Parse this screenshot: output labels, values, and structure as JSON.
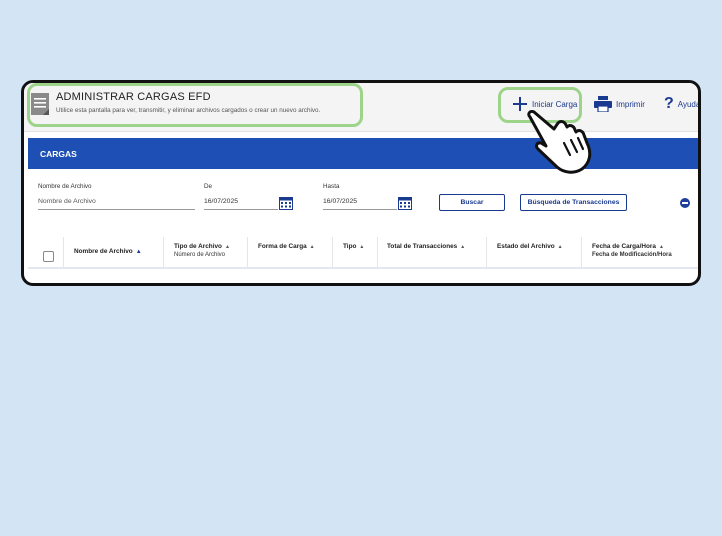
{
  "header": {
    "title": "ADMINISTRAR CARGAS EFD",
    "subtitle": "Utilice esta pantalla para ver, transmitir, y eliminar archivos cargados o crear un nuevo archivo.",
    "icon": "document-icon"
  },
  "toolbar": {
    "iniciar_label": "Iniciar Carga",
    "imprimir_label": "Imprimir",
    "ayuda_label": "Ayuda"
  },
  "section": {
    "title": "CARGAS"
  },
  "filters": {
    "nombre_label": "Nombre de Archivo",
    "nombre_placeholder": "Nombre de Archivo",
    "de_label": "De",
    "de_value": "16/07/2025",
    "hasta_label": "Hasta",
    "hasta_value": "16/07/2025",
    "buscar_label": "Buscar",
    "busqueda_label": "Búsqueda de Transacciones"
  },
  "table": {
    "columns": [
      {
        "label": "Nombre de Archivo",
        "sub": ""
      },
      {
        "label": "Tipo de Archivo",
        "sub": "Número de Archivo"
      },
      {
        "label": "Forma de Carga",
        "sub": ""
      },
      {
        "label": "Tipo",
        "sub": ""
      },
      {
        "label": "Total de Transacciones",
        "sub": ""
      },
      {
        "label": "Estado del Archivo",
        "sub": ""
      },
      {
        "label": "Fecha de Carga/Hora",
        "sub": "Fecha de Modificación/Hora"
      }
    ]
  },
  "colors": {
    "accent": "#1e4fb4",
    "highlight": "#9ed48a",
    "background": "#d3e4f5"
  }
}
